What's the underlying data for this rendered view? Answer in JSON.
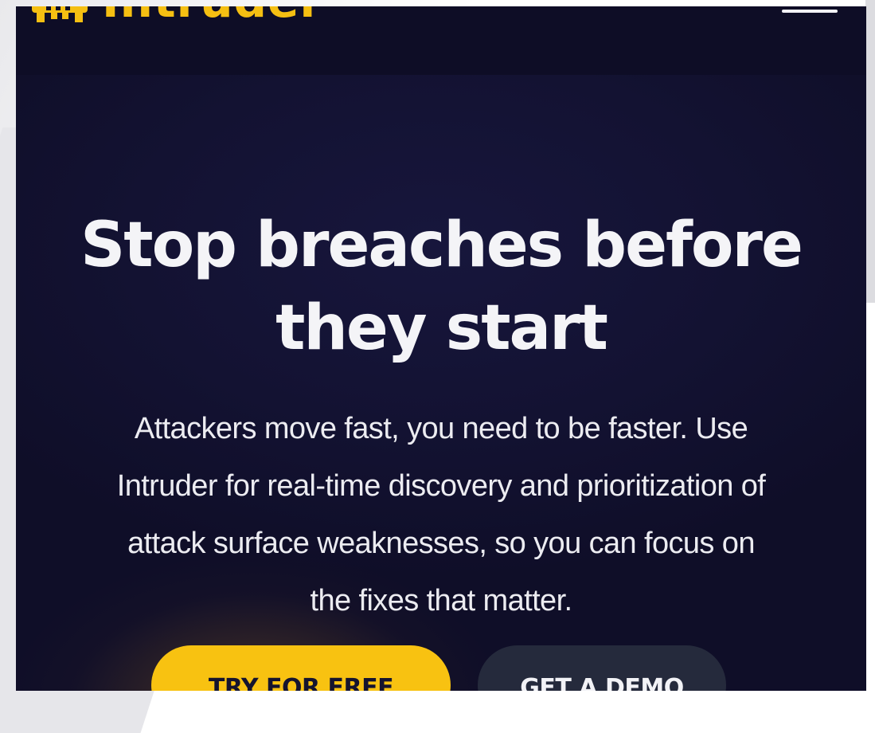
{
  "brand": {
    "name": "Intruder",
    "color": "#f5bf12"
  },
  "header": {
    "menu_icon": "hamburger-menu-icon"
  },
  "hero": {
    "title_line1": "Stop breaches before",
    "title_line2": "they start",
    "subtitle_lines": [
      "Attackers move fast, you need to be faster. Use",
      "Intruder for real-time discovery and prioritization of",
      "attack surface weaknesses, so you can focus on",
      "the fixes that matter."
    ]
  },
  "cta": {
    "primary_label": "TRY FOR FREE",
    "secondary_label": "GET A DEMO",
    "primary_color": "#f8c211",
    "secondary_color": "#252a3c"
  },
  "colors": {
    "background": "#131232",
    "text": "#f4f4f7"
  }
}
